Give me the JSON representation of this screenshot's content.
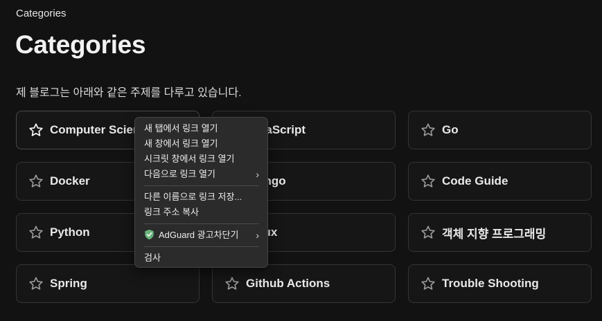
{
  "breadcrumb": "Categories",
  "page_title": "Categories",
  "intro": "제 블로그는 아래와 같은 주제를 다루고 있습니다.",
  "categories": [
    {
      "label": "Computer Science"
    },
    {
      "label": "JavaScript"
    },
    {
      "label": "Go"
    },
    {
      "label": "Docker"
    },
    {
      "label": "Django"
    },
    {
      "label": "Code Guide"
    },
    {
      "label": "Python"
    },
    {
      "label": "Linux"
    },
    {
      "label": "객체 지향 프로그래밍"
    },
    {
      "label": "Spring"
    },
    {
      "label": "Github Actions"
    },
    {
      "label": "Trouble Shooting"
    }
  ],
  "context_menu": {
    "open_new_tab": "새 탭에서 링크 열기",
    "open_new_window": "새 창에서 링크 열기",
    "open_secret_window": "시크릿 창에서 링크 열기",
    "open_with": "다음으로 링크 열기",
    "save_link_as": "다른 이름으로 링크 저장...",
    "copy_link": "링크 주소 복사",
    "adguard": "AdGuard 광고차단기",
    "inspect": "검사",
    "icons": {
      "submenu": "chevron-right-icon",
      "adguard": "shield-check-icon"
    }
  },
  "colors": {
    "background": "#121212",
    "card_border": "#353535",
    "menu_bg": "#2b2b2b",
    "adguard_green": "#67b279"
  }
}
